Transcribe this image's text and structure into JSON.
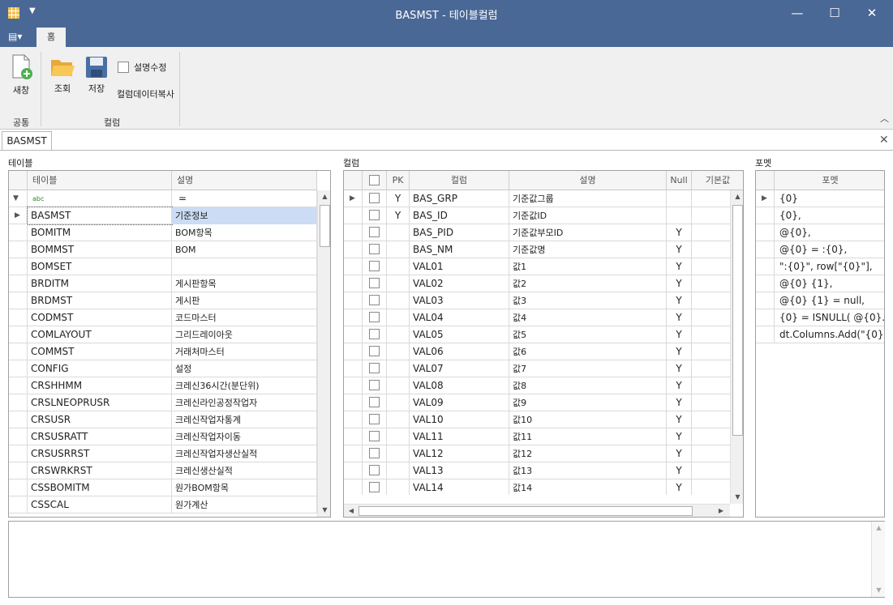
{
  "window": {
    "title": "BASMST - 테이블컬럼"
  },
  "ribbon": {
    "tab_home": "홈",
    "new_label": "새창",
    "query_label": "조회",
    "save_label": "저장",
    "edit_desc_label": "설명수정",
    "copy_col_label": "컬럼데이터복사",
    "group_common": "공통",
    "group_column": "컬럼"
  },
  "doc_tab": "BASMST",
  "tables_panel": {
    "label": "테이블",
    "headers": [
      "테이블",
      "설명"
    ],
    "filter_op": "=",
    "rows": [
      [
        "BASMST",
        "기준정보"
      ],
      [
        "BOMITM",
        "BOM항목"
      ],
      [
        "BOMMST",
        "BOM"
      ],
      [
        "BOMSET",
        ""
      ],
      [
        "BRDITM",
        "게시판항목"
      ],
      [
        "BRDMST",
        "게시판"
      ],
      [
        "CODMST",
        "코드마스터"
      ],
      [
        "COMLAYOUT",
        "그리드레이아웃"
      ],
      [
        "COMMST",
        "거래처마스터"
      ],
      [
        "CONFIG",
        "설정"
      ],
      [
        "CRSHHMM",
        "크레신36시간(분단위)"
      ],
      [
        "CRSLNEOPRUSR",
        "크레신라인공정작업자"
      ],
      [
        "CRSUSR",
        "크레신작업자통계"
      ],
      [
        "CRSUSRATT",
        "크레신작업자이동"
      ],
      [
        "CRSUSRRST",
        "크레신작업자생산실적"
      ],
      [
        "CRSWRKRST",
        "크레신생산실적"
      ],
      [
        "CSSBOMITM",
        "원가BOM항목"
      ],
      [
        "CSSCAL",
        "원가계산"
      ]
    ]
  },
  "columns_panel": {
    "label": "컬럼",
    "headers": [
      "PK",
      "컬럼",
      "설명",
      "Null",
      "기본값"
    ],
    "rows": [
      [
        "Y",
        "BAS_GRP",
        "기준값그룹",
        ""
      ],
      [
        "Y",
        "BAS_ID",
        "기준값ID",
        ""
      ],
      [
        "",
        "BAS_PID",
        "기준값부모ID",
        "Y"
      ],
      [
        "",
        "BAS_NM",
        "기준값명",
        "Y"
      ],
      [
        "",
        "VAL01",
        "값1",
        "Y"
      ],
      [
        "",
        "VAL02",
        "값2",
        "Y"
      ],
      [
        "",
        "VAL03",
        "값3",
        "Y"
      ],
      [
        "",
        "VAL04",
        "값4",
        "Y"
      ],
      [
        "",
        "VAL05",
        "값5",
        "Y"
      ],
      [
        "",
        "VAL06",
        "값6",
        "Y"
      ],
      [
        "",
        "VAL07",
        "값7",
        "Y"
      ],
      [
        "",
        "VAL08",
        "값8",
        "Y"
      ],
      [
        "",
        "VAL09",
        "값9",
        "Y"
      ],
      [
        "",
        "VAL10",
        "값10",
        "Y"
      ],
      [
        "",
        "VAL11",
        "값11",
        "Y"
      ],
      [
        "",
        "VAL12",
        "값12",
        "Y"
      ],
      [
        "",
        "VAL13",
        "값13",
        "Y"
      ],
      [
        "",
        "VAL14",
        "값14",
        "Y"
      ]
    ]
  },
  "format_panel": {
    "label": "포멧",
    "header": "포멧",
    "rows": [
      "{0}",
      "{0},",
      "@{0},",
      "@{0} = :{0},",
      "\":{0}\", row[\"{0}\"],",
      "@{0} {1},",
      "@{0} {1} = null,",
      "{0} = ISNULL( @{0}...",
      "dt.Columns.Add(\"{0}\"..."
    ]
  }
}
